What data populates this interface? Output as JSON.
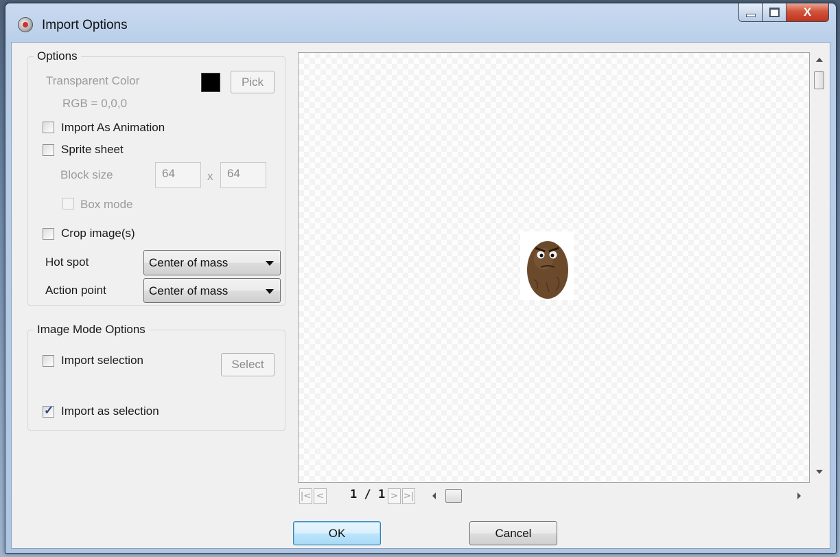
{
  "window": {
    "title": "Import Options",
    "close_glyph": "X"
  },
  "options": {
    "group_title": "Options",
    "transparent_color_label": "Transparent Color",
    "transparent_color": "#000000",
    "rgb_text": "RGB = 0,0,0",
    "pick_label": "Pick",
    "import_as_animation": {
      "label": "Import As Animation",
      "checked": false
    },
    "sprite_sheet": {
      "label": "Sprite sheet",
      "checked": false
    },
    "block_size_label": "Block size",
    "block_width": "64",
    "block_separator": "x",
    "block_height": "64",
    "box_mode": {
      "label": "Box mode",
      "checked": false
    },
    "crop_images": {
      "label": "Crop image(s)",
      "checked": false
    },
    "hot_spot_label": "Hot spot",
    "hot_spot_value": "Center of mass",
    "action_point_label": "Action point",
    "action_point_value": "Center of mass"
  },
  "image_mode": {
    "group_title": "Image Mode Options",
    "import_selection": {
      "label": "Import selection",
      "checked": false
    },
    "select_label": "Select",
    "import_as_selection": {
      "label": "Import as selection",
      "checked": true
    }
  },
  "preview": {
    "page_text": "1 / 1",
    "nav": {
      "first": "|<",
      "prev": "<",
      "next": ">",
      "last": ">|"
    }
  },
  "buttons": {
    "ok": "OK",
    "cancel": "Cancel"
  }
}
